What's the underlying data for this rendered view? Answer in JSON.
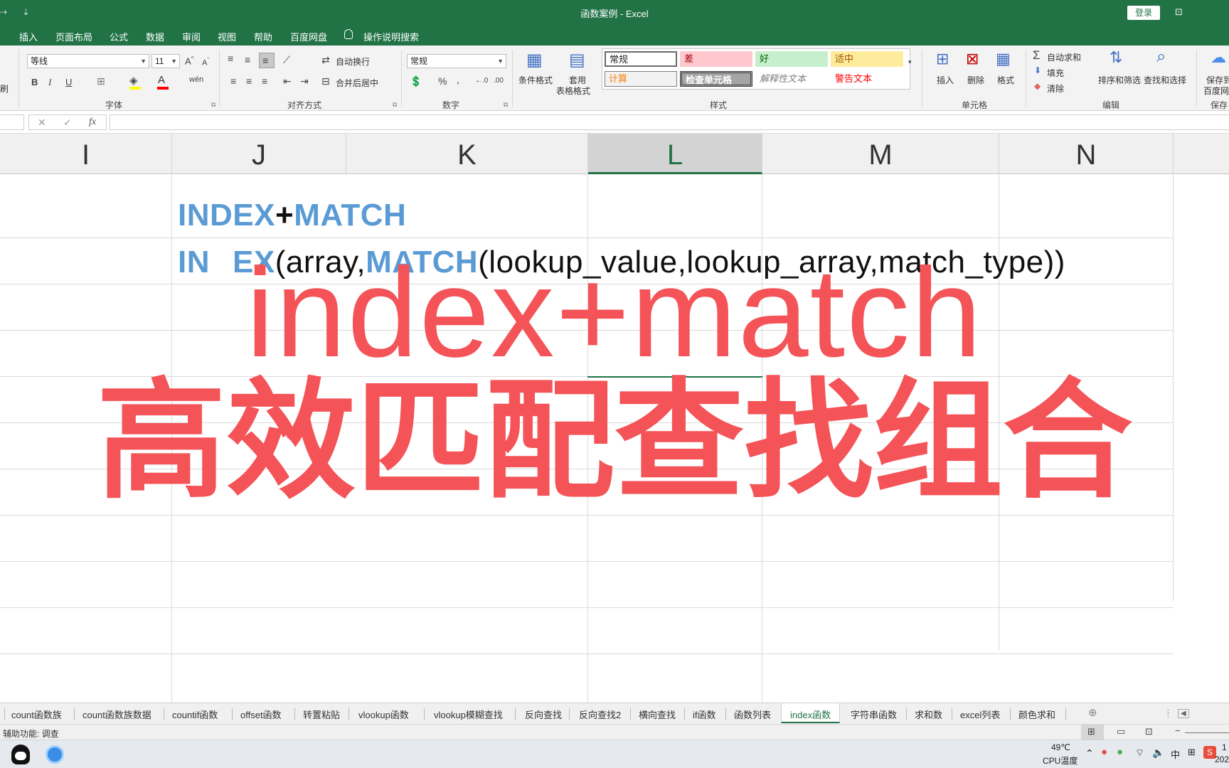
{
  "titlebar": {
    "title": "函数案例  -  Excel",
    "login": "登录",
    "qa_arrow": "⇢",
    "qa_more": "⇣"
  },
  "menu": {
    "tabs": [
      "插入",
      "页面布局",
      "公式",
      "数据",
      "审阅",
      "视图",
      "帮助",
      "百度网盘"
    ],
    "search": "操作说明搜索"
  },
  "ribbon": {
    "font_name": "等线",
    "font_size": "11",
    "font_group": "字体",
    "align_group": "对齐方式",
    "wrap_text": "自动换行",
    "merge_center": "合并后居中",
    "number_format": "常规",
    "number_group": "数字",
    "cond_format": "条件格式",
    "table_format_1": "套用",
    "table_format_2": "表格格式",
    "styles_group": "样式",
    "styles": {
      "normal": "常规",
      "bad": "差",
      "good": "好",
      "neutral": "适中",
      "calc": "计算",
      "check": "检查单元格",
      "explain": "解释性文本",
      "warning": "警告文本"
    },
    "insert": "插入",
    "delete": "删除",
    "format": "格式",
    "cells_group": "单元格",
    "autosum": "自动求和",
    "fill": "填充",
    "clear": "清除",
    "sort_filter": "排序和筛选",
    "find_select": "查找和选择",
    "edit_group": "编辑",
    "save_baidu_1": "保存到",
    "save_baidu_2": "百度网",
    "save_group": "保存",
    "left_clip": "刷"
  },
  "formula_bar": {
    "cancel": "✕",
    "enter": "✓",
    "fx": "fx",
    "value": ""
  },
  "columns": [
    "I",
    "J",
    "K",
    "L",
    "M",
    "N"
  ],
  "cells": {
    "j1_a": "INDEX",
    "j1_plus": "+",
    "j1_b": "MATCH",
    "j2_a": "IN",
    "j2_b": "EX",
    "j2_c": "(array,",
    "j2_d": "MATCH",
    "j2_e": "(lookup_value,lookup_array,match_type))"
  },
  "overlay": {
    "line1": "index+match",
    "line2": "高效匹配查找组合"
  },
  "sheets": [
    "count函数族",
    "count函数族数据",
    "countif函数",
    "offset函数",
    "转置粘贴",
    "vlookup函数",
    "vlookup模糊查找",
    "反向查找",
    "反向查找2",
    "横向查找",
    "if函数",
    "函数列表",
    "index函数",
    "字符串函数",
    "求和数",
    "excel列表",
    "颜色求和"
  ],
  "active_sheet": "index函数",
  "status": {
    "accessibility": "辅助功能: 调查"
  },
  "taskbar": {
    "temp": "49℃",
    "temp_label": "CPU温度",
    "ime": "中",
    "clock_top": "1",
    "clock_bottom": "202"
  }
}
